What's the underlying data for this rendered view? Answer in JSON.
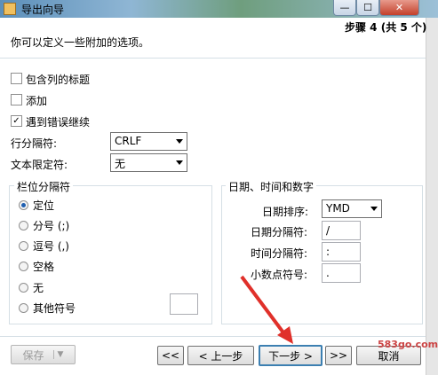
{
  "window": {
    "title": "导出向导",
    "close_glyph": "✕",
    "min_glyph": "—",
    "max_glyph": "☐"
  },
  "header": {
    "step": "步骤 4 (共 5 个)",
    "description": "你可以定义一些附加的选项。"
  },
  "options": [
    {
      "label": "包含列的标题",
      "checked": false,
      "check_glyph": ""
    },
    {
      "label": "添加",
      "checked": false,
      "check_glyph": ""
    },
    {
      "label": "遇到错误继续",
      "checked": true,
      "check_glyph": "✓"
    }
  ],
  "row_delimiter": {
    "label": "行分隔符:",
    "value": "CRLF"
  },
  "text_qualifier": {
    "label": "文本限定符:",
    "value": "无"
  },
  "field_delimiter": {
    "title": "栏位分隔符",
    "options": [
      {
        "label": "定位",
        "selected": true
      },
      {
        "label": "分号 (;)",
        "selected": false
      },
      {
        "label": "逗号 (,)",
        "selected": false
      },
      {
        "label": "空格",
        "selected": false
      },
      {
        "label": "无",
        "selected": false
      },
      {
        "label": "其他符号",
        "selected": false
      }
    ],
    "other_value": ""
  },
  "datetime": {
    "title": "日期、时间和数字",
    "date_order_label": "日期排序:",
    "date_order_value": "YMD",
    "date_sep_label": "日期分隔符:",
    "date_sep_value": "/",
    "time_sep_label": "时间分隔符:",
    "time_sep_value": ":",
    "decimal_label": "小数点符号:",
    "decimal_value": "."
  },
  "footer": {
    "save": "保存",
    "first": "<<",
    "prev": "< 上一步",
    "next": "下一步 >",
    "last": ">>",
    "cancel": "取消"
  },
  "watermark": "583go.com"
}
